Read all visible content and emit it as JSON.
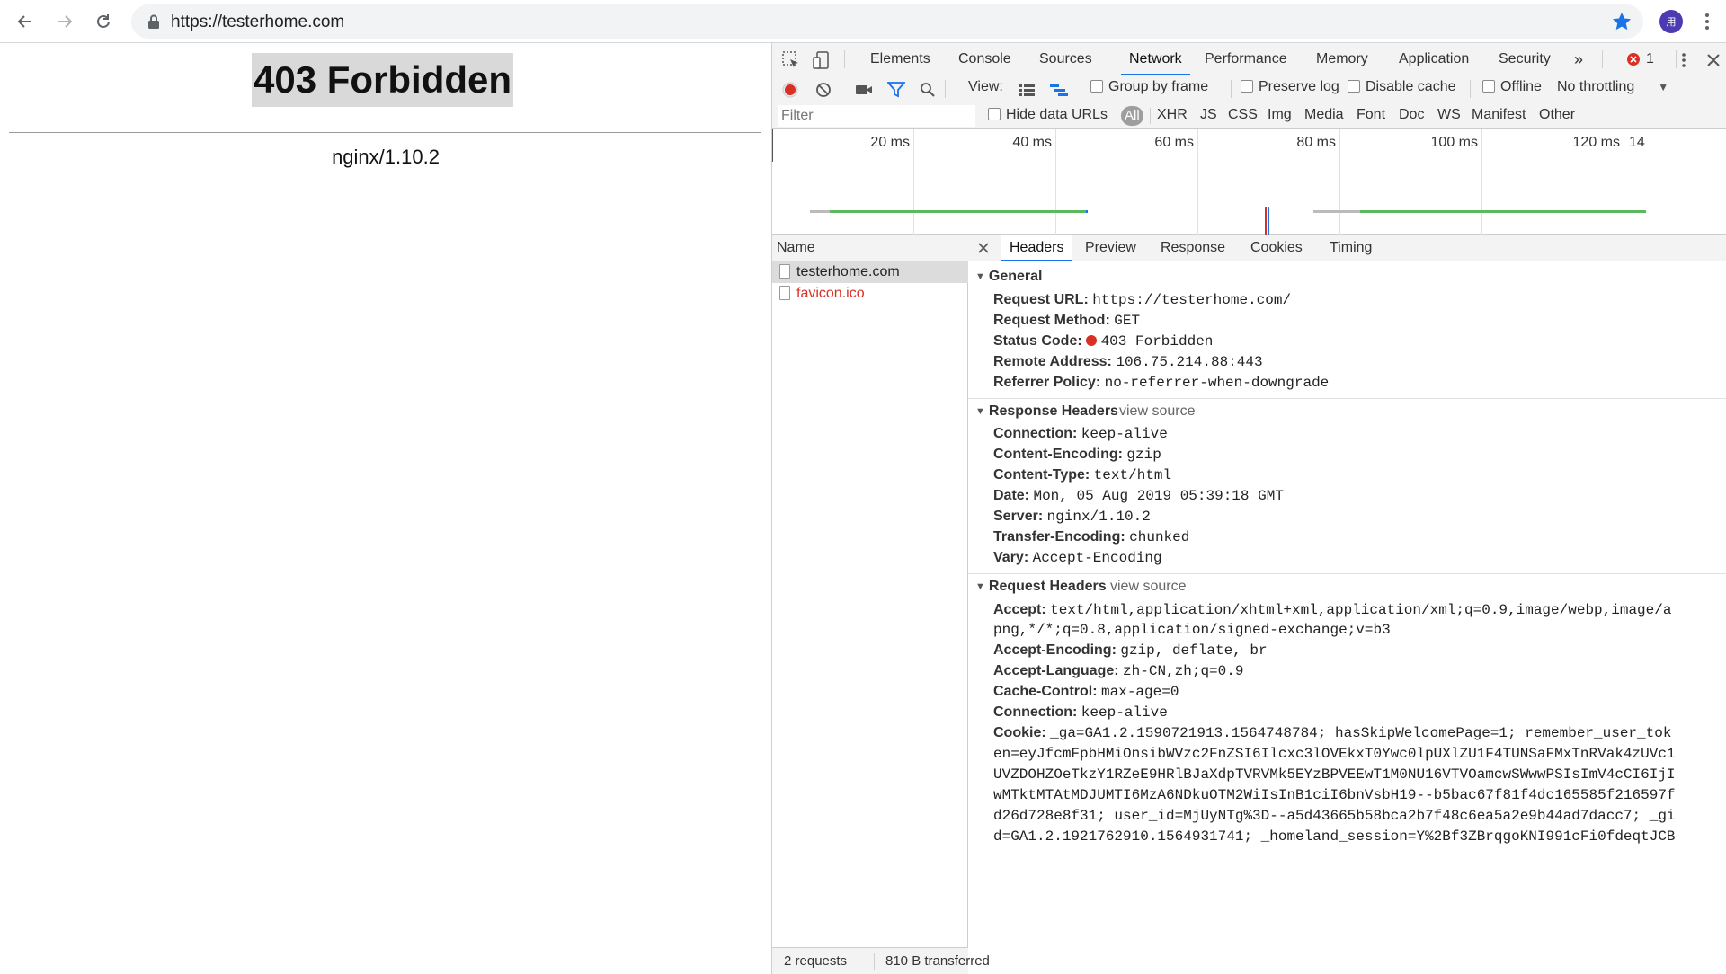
{
  "browser": {
    "url": "https://testerhome.com",
    "avatar_initial": "用"
  },
  "page": {
    "heading": "403 Forbidden",
    "server": "nginx/1.10.2"
  },
  "devtools": {
    "tabs": [
      "Elements",
      "Console",
      "Sources",
      "Network",
      "Performance",
      "Memory",
      "Application",
      "Security"
    ],
    "active_tab": "Network",
    "more_tabs": "»",
    "error_count": "1",
    "controls": {
      "view_label": "View:",
      "group_by_frame": "Group by frame",
      "preserve_log": "Preserve log",
      "disable_cache": "Disable cache",
      "offline": "Offline",
      "throttling": "No throttling"
    },
    "filter": {
      "placeholder": "Filter",
      "hide_data_urls": "Hide data URLs",
      "types": [
        "All",
        "XHR",
        "JS",
        "CSS",
        "Img",
        "Media",
        "Font",
        "Doc",
        "WS",
        "Manifest",
        "Other"
      ]
    },
    "timeline_ticks": [
      "20 ms",
      "40 ms",
      "60 ms",
      "80 ms",
      "100 ms",
      "120 ms",
      "14"
    ],
    "requests": {
      "column": "Name",
      "items": [
        {
          "name": "testerhome.com",
          "color": "#222222"
        },
        {
          "name": "favicon.ico",
          "color": "#d93025"
        }
      ],
      "summary_count": "2 requests",
      "summary_transfer": "810 B transferred"
    },
    "detail_tabs": [
      "Headers",
      "Preview",
      "Response",
      "Cookies",
      "Timing"
    ],
    "general": {
      "title": "General",
      "rows": [
        {
          "name": "Request URL:",
          "value": "https://testerhome.com/"
        },
        {
          "name": "Request Method:",
          "value": "GET"
        },
        {
          "name": "Status Code:",
          "value": "403 Forbidden"
        },
        {
          "name": "Remote Address:",
          "value": "106.75.214.88:443"
        },
        {
          "name": "Referrer Policy:",
          "value": "no-referrer-when-downgrade"
        }
      ]
    },
    "response_headers": {
      "title": "Response Headers",
      "view_source": "view source",
      "rows": [
        {
          "name": "Connection:",
          "value": "keep-alive"
        },
        {
          "name": "Content-Encoding:",
          "value": "gzip"
        },
        {
          "name": "Content-Type:",
          "value": "text/html"
        },
        {
          "name": "Date:",
          "value": "Mon, 05 Aug 2019 05:39:18 GMT"
        },
        {
          "name": "Server:",
          "value": "nginx/1.10.2"
        },
        {
          "name": "Transfer-Encoding:",
          "value": "chunked"
        },
        {
          "name": "Vary:",
          "value": "Accept-Encoding"
        }
      ]
    },
    "request_headers": {
      "title": "Request Headers",
      "view_source": "view source",
      "accept_name": "Accept:",
      "accept_line1": "text/html,application/xhtml+xml,application/xml;q=0.9,image/webp,image/a",
      "accept_line2": "png,*/*;q=0.8,application/signed-exchange;v=b3",
      "rows": [
        {
          "name": "Accept-Encoding:",
          "value": "gzip, deflate, br"
        },
        {
          "name": "Accept-Language:",
          "value": "zh-CN,zh;q=0.9"
        },
        {
          "name": "Cache-Control:",
          "value": "max-age=0"
        },
        {
          "name": "Connection:",
          "value": "keep-alive"
        }
      ],
      "cookie_name": "Cookie:",
      "cookie_lines": [
        "_ga=GA1.2.1590721913.1564748784; hasSkipWelcomePage=1; remember_user_tok",
        "en=eyJfcmFpbHMiOnsibWVzc2FnZSI6Ilcxc3lOVEkxT0Ywc0lpUXlZU1F4TUNSaFMxTnRVak4zUVc1",
        "UVZDOHZOeTkzY1RZeE9HRlBJaXdpTVRVMk5EYzBPVEEwT1M0NU16VTVOamcwSWwwPSIsImV4cCI6IjI",
        "wMTktMTAtMDJUMTI6MzA6NDkuOTM2WiIsInB1ciI6bnVsbH19--b5bac67f81f4dc165585f216597f",
        "d26d728e8f31; user_id=MjUyNTg%3D--a5d43665b58bca2b7f48c6ea5a2e9b44ad7dacc7; _gi",
        "d=GA1.2.1921762910.1564931741; _homeland_session=Y%2Bf3ZBrqgoKNI991cFi0fdeqtJCB"
      ]
    }
  }
}
